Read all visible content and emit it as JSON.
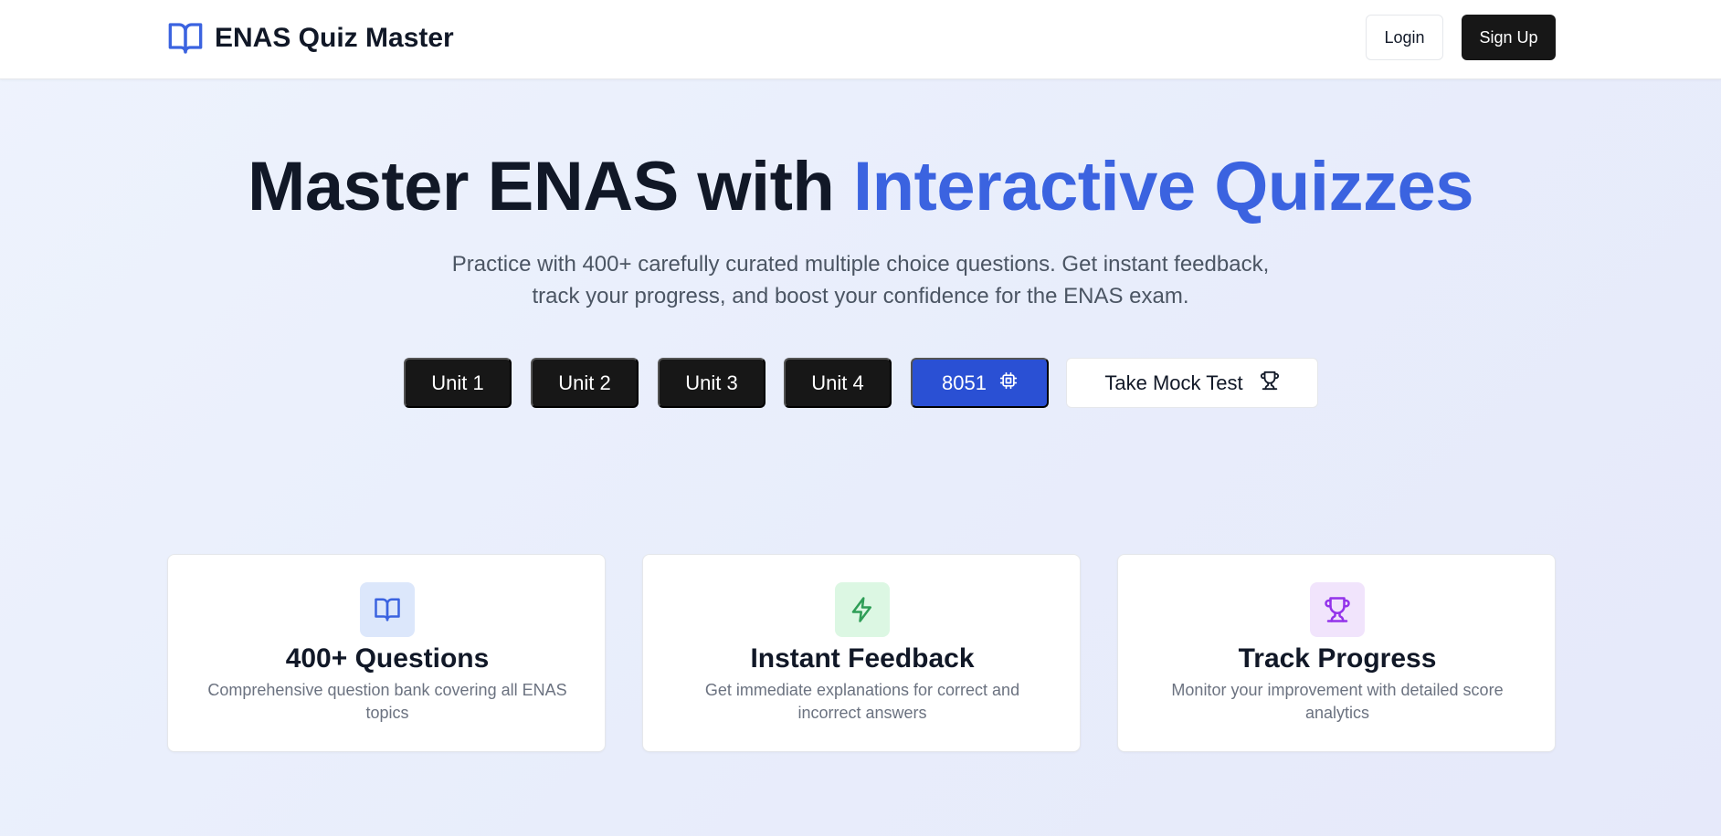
{
  "header": {
    "brand_icon": "open-book-icon",
    "brand_title": "ENAS Quiz Master",
    "login_label": "Login",
    "signup_label": "Sign Up"
  },
  "hero": {
    "title_main": "Master ENAS with ",
    "title_accent": "Interactive Quizzes",
    "subtitle_line1": "Practice with 400+ carefully curated multiple choice questions. Get instant feedback,",
    "subtitle_line2": "track your progress, and boost your confidence for the ENAS exam.",
    "units": [
      "Unit 1",
      "Unit 2",
      "Unit 3",
      "Unit 4"
    ],
    "chip_button": {
      "label": "8051",
      "icon": "cpu-chip-icon"
    },
    "mock_button": {
      "label": "Take Mock Test",
      "icon": "trophy-icon"
    }
  },
  "features": [
    {
      "icon": "open-book-icon",
      "title": "400+ Questions",
      "description": "Comprehensive question bank covering all ENAS topics"
    },
    {
      "icon": "lightning-bolt-icon",
      "title": "Instant Feedback",
      "description": "Get immediate explanations for correct and incorrect answers"
    },
    {
      "icon": "trophy-icon",
      "title": "Track Progress",
      "description": "Monitor your improvement with detailed score analytics"
    }
  ],
  "colors": {
    "accent": "#3b63e0",
    "primary_button": "#2a50d4",
    "dark_button": "#171717",
    "feature_icon_bg_blue": "#dce7fb",
    "feature_icon_bg_green": "#dcf7e3",
    "feature_icon_bg_purple": "#f1e4fc"
  }
}
